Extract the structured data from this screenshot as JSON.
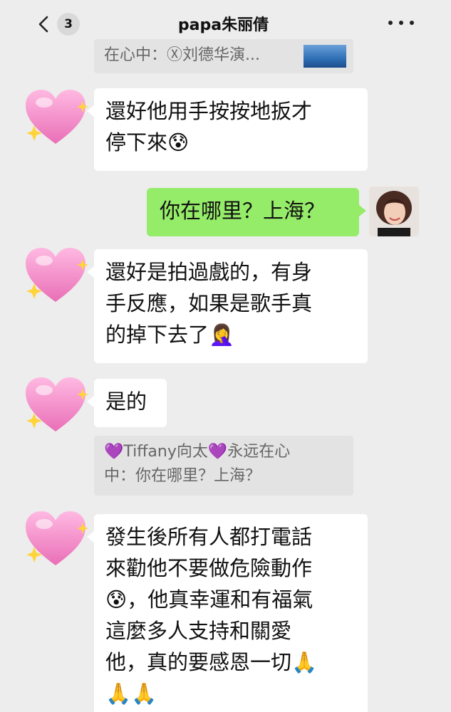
{
  "header": {
    "back_count": "3",
    "title": "papa朱丽倩"
  },
  "quoted_top": "在心中：Ⓧ刘德华演...",
  "messages": [
    {
      "text": "還好他用手按按地扳才停下來😰"
    },
    {
      "text": "你在哪里？上海？"
    },
    {
      "text": "還好是拍過戲的，有身手反應，如果是歌手真的掉下去了🤦‍♀️"
    },
    {
      "text": "是的"
    },
    {
      "text": "💜Tiffany向太💜永远在心中：你在哪里？上海？"
    },
    {
      "text": "發生後所有人都打電話來勸他不要做危險動作😰，他真幸運和有福氣這麼多人支持和關愛他，真的要感恩一切🙏🙏🙏"
    }
  ],
  "lines": {
    "m1": [
      "還好他用手按按地扳才",
      "停下來😰"
    ],
    "m3": [
      "還好是拍過戲的，有身",
      "手反應，如果是歌手真",
      "的掉下去了🤦‍♀️"
    ],
    "m5": [
      "💜Tiffany向太💜永远在心",
      "中：你在哪里？上海？"
    ],
    "m6": [
      "發生後所有人都打電話",
      "來勸他不要做危險動作",
      "😰，他真幸運和有福氣",
      "這麼多人支持和關愛",
      "他，真的要感恩一切🙏",
      "🙏🙏"
    ]
  },
  "colors": {
    "background": "#ededed",
    "incoming_bubble": "#ffffff",
    "outgoing_bubble": "#95ec69",
    "quote_bg": "#e3e3e3"
  },
  "icons": [
    "back-chevron-icon",
    "more-dots-icon",
    "heart-sparkle-avatar-icon"
  ]
}
